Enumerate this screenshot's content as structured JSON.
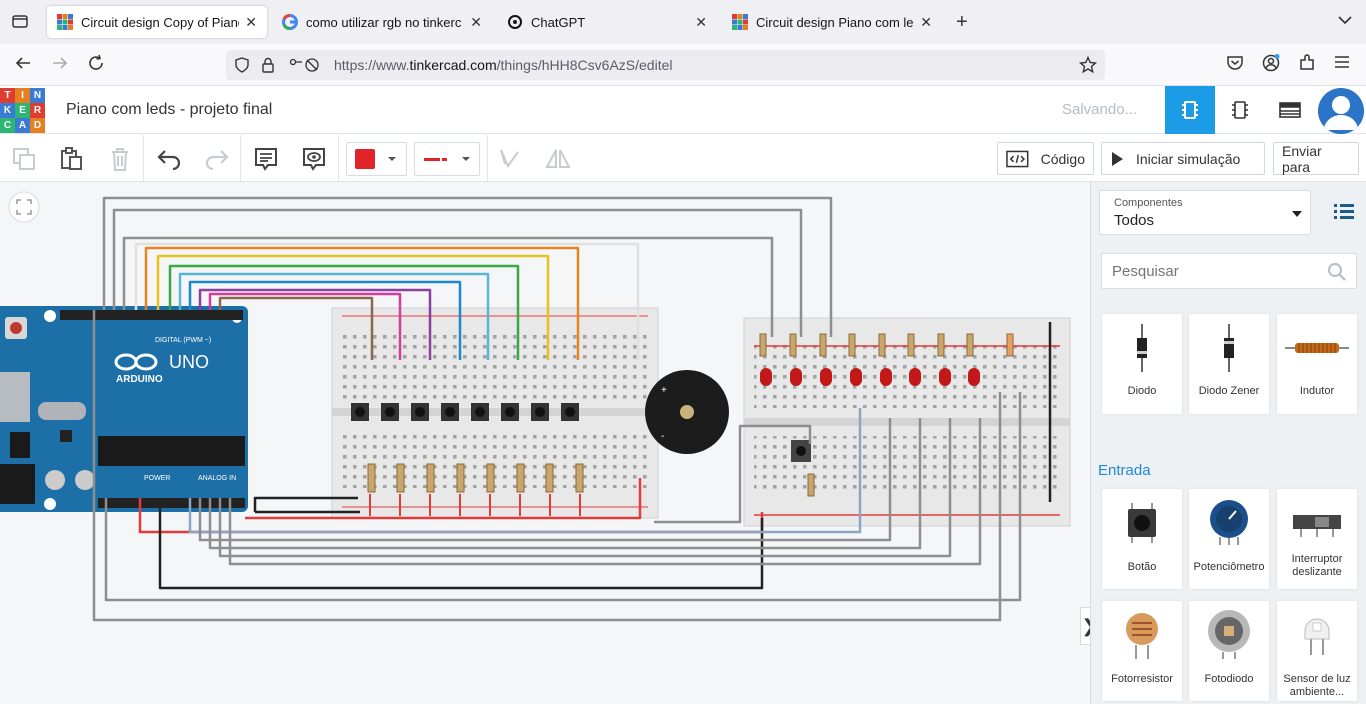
{
  "browser": {
    "tabs": [
      {
        "title": "Circuit design Copy of Piano",
        "active": true
      },
      {
        "title": "como utilizar rgb no tinkerc",
        "active": false
      },
      {
        "title": "ChatGPT",
        "active": false
      },
      {
        "title": "Circuit design Piano com led",
        "active": false
      }
    ],
    "url_prefix": "https://www.",
    "url_domain": "tinkercad.com",
    "url_path": "/things/hHH8Csv6AzS/editel"
  },
  "header": {
    "logo_letters": [
      "T",
      "I",
      "N",
      "K",
      "E",
      "R",
      "C",
      "A",
      "D"
    ],
    "project_title": "Piano com leds - projeto final",
    "status": "Salvando..."
  },
  "toolbar": {
    "code_label": "Código",
    "simulate_label": "Iniciar simulação",
    "send_label": "Enviar para",
    "wire_color": "#e0242a"
  },
  "panel": {
    "components_label": "Componentes",
    "components_value": "Todos",
    "search_placeholder": "Pesquisar",
    "section_input": "Entrada",
    "row1": [
      "Diodo",
      "Diodo Zener",
      "Indutor"
    ],
    "row2": [
      "Botão",
      "Potenciômetro",
      "Interruptor deslizante"
    ],
    "row3": [
      "Fotorresistor",
      "Fotodiodo",
      "Sensor de luz ambiente..."
    ]
  },
  "board": {
    "brand": "ARDUINO",
    "model": "UNO",
    "digital_label": "DIGITAL (PWM ~)",
    "power_label": "POWER",
    "analog_label": "ANALOG IN"
  }
}
